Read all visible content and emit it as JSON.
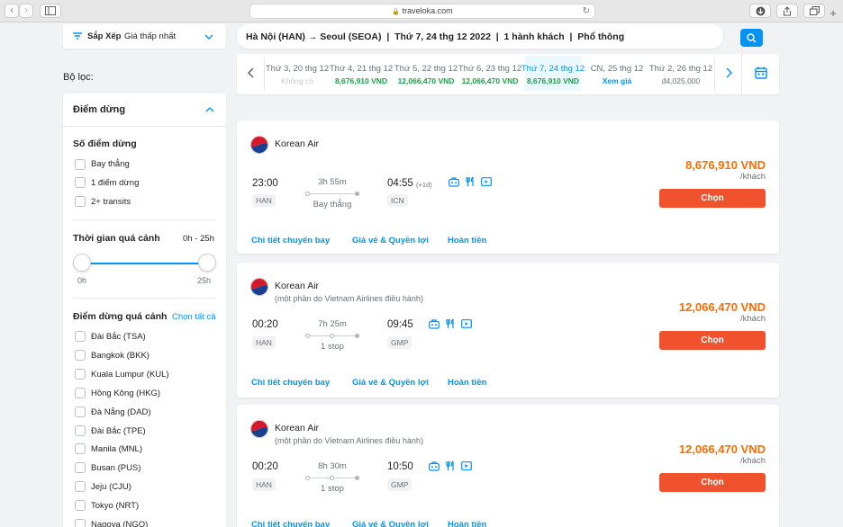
{
  "browser": {
    "url": "traveloka.com",
    "reload_icon": "↻",
    "back_icon": "‹",
    "forward_icon": "›",
    "new_tab_icon": "+"
  },
  "sort": {
    "label": "Sắp Xếp",
    "value": "Giá thấp nhất"
  },
  "search": {
    "summary": "Hà Nội (HAN) → Seoul (SEOA)  |  Thứ 7, 24 thg 12 2022  |  1 hành khách  |  Phổ thông"
  },
  "date_tabs": [
    {
      "date": "Thứ 3, 20 thg 12",
      "price": "Không có",
      "state": "none"
    },
    {
      "date": "Thứ 4, 21 thg 12",
      "price": "8,676,910 VND",
      "state": "green"
    },
    {
      "date": "Thứ 5, 22 thg 12",
      "price": "12,066,470 VND",
      "state": "green"
    },
    {
      "date": "Thứ 6, 23 thg 12",
      "price": "12,066,470 VND",
      "state": "green"
    },
    {
      "date": "Thứ 7, 24 thg 12",
      "price": "8,676,910 VND",
      "state": "selected"
    },
    {
      "date": "CN, 25 thg 12",
      "price": "Xem giá",
      "state": "link"
    },
    {
      "date": "Thứ 2, 26 thg 12",
      "price": "đ4,025,000",
      "state": "muted"
    }
  ],
  "filters": {
    "title": "Bộ lọc:",
    "stops_section": "Điểm dừng",
    "stops_heading": "Số điểm dừng",
    "stops_options": [
      "Bay thẳng",
      "1 điểm dừng",
      "2+ transits"
    ],
    "layover_time": {
      "heading": "Thời gian quá cảnh",
      "range_label": "0h - 25h",
      "min_label": "0h",
      "max_label": "25h",
      "min_value": 0,
      "max_value": 25
    },
    "layover_points": {
      "heading": "Điểm dừng quá cảnh",
      "select_all": "Chọn tất cả",
      "options": [
        "Đài Bắc (TSA)",
        "Bangkok (BKK)",
        "Kuala Lumpur (KUL)",
        "Hồng Kông (HKG)",
        "Đà Nẵng (DAD)",
        "Đài Bắc (TPE)",
        "Manila (MNL)",
        "Busan (PUS)",
        "Jeju (CJU)",
        "Tokyo (NRT)",
        "Nagoya (NGO)"
      ]
    }
  },
  "flights": [
    {
      "airline": "Korean Air",
      "operated_by": "",
      "depart_time": "23:00",
      "depart_code": "HAN",
      "duration": "3h 55m",
      "stops": "Bay thẳng",
      "arrive_time": "04:55",
      "day_offset": "(+1d)",
      "arrive_code": "ICN",
      "price": "8,676,910 VND",
      "per_pax": "/khách",
      "select_label": "Chọn",
      "links": [
        "Chi tiết chuyến bay",
        "Giá vé & Quyền lợi",
        "Hoàn tiền"
      ]
    },
    {
      "airline": "Korean Air",
      "operated_by": "(một phần do Vietnam Airlines điều hành)",
      "depart_time": "00:20",
      "depart_code": "HAN",
      "duration": "7h 25m",
      "stops": "1 stop",
      "arrive_time": "09:45",
      "day_offset": "",
      "arrive_code": "GMP",
      "price": "12,066,470 VND",
      "per_pax": "/khách",
      "select_label": "Chọn",
      "links": [
        "Chi tiết chuyến bay",
        "Giá vé & Quyền lợi",
        "Hoàn tiền"
      ]
    },
    {
      "airline": "Korean Air",
      "operated_by": "(một phần do Vietnam Airlines điều hành)",
      "depart_time": "00:20",
      "depart_code": "HAN",
      "duration": "8h 30m",
      "stops": "1 stop",
      "arrive_time": "10:50",
      "day_offset": "",
      "arrive_code": "GMP",
      "price": "12,066,470 VND",
      "per_pax": "/khách",
      "select_label": "Chọn",
      "links": [
        "Chi tiết chuyến bay",
        "Giá vé & Quyền lợi",
        "Hoàn tiền"
      ]
    }
  ],
  "colors": {
    "brand_blue": "#0194f3",
    "price_orange": "#f96d01",
    "select_button": "#f0522e",
    "green_price": "#1d9e4a"
  }
}
